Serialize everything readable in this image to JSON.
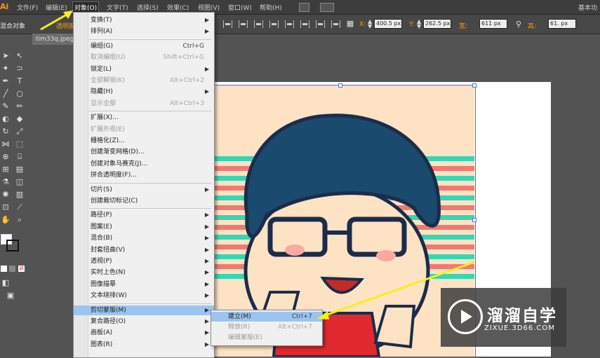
{
  "menubar": {
    "logo": "Ai",
    "items": [
      "文件(F)",
      "编辑(E)",
      "对象(O)",
      "文字(T)",
      "选择(S)",
      "效果(C)",
      "视图(V)",
      "窗口(W)",
      "帮助(H)"
    ],
    "right_label": "基本功"
  },
  "ctrlbar": {
    "left_label": "混合对象",
    "opacity_label": "透明度",
    "x_label": "X:",
    "x_value": "400.5 px",
    "y_label": "Y:",
    "y_value": "262.5 px",
    "w_label": "宽:",
    "w_value": "611 px",
    "h_label": "高:",
    "h_value": "61. px"
  },
  "document": {
    "tab_label": "tim33q.jpeg@"
  },
  "object_menu": [
    {
      "label": "变换(T)",
      "shortcut": "",
      "submenu": true,
      "disabled": false
    },
    {
      "label": "排列(A)",
      "shortcut": "",
      "submenu": true,
      "disabled": false
    },
    {
      "separator": true
    },
    {
      "label": "编组(G)",
      "shortcut": "Ctrl+G",
      "submenu": false,
      "disabled": false
    },
    {
      "label": "取消编组(U)",
      "shortcut": "Shift+Ctrl+G",
      "submenu": false,
      "disabled": true
    },
    {
      "label": "锁定(L)",
      "shortcut": "",
      "submenu": true,
      "disabled": false
    },
    {
      "label": "全部解锁(K)",
      "shortcut": "Alt+Ctrl+2",
      "submenu": false,
      "disabled": true
    },
    {
      "label": "隐藏(H)",
      "shortcut": "",
      "submenu": true,
      "disabled": false
    },
    {
      "label": "显示全部",
      "shortcut": "Alt+Ctrl+3",
      "submenu": false,
      "disabled": true
    },
    {
      "separator": true
    },
    {
      "label": "扩展(X)...",
      "shortcut": "",
      "submenu": false,
      "disabled": false
    },
    {
      "label": "扩展外观(E)",
      "shortcut": "",
      "submenu": false,
      "disabled": true
    },
    {
      "label": "栅格化(Z)...",
      "shortcut": "",
      "submenu": false,
      "disabled": false
    },
    {
      "label": "创建渐变网格(D)...",
      "shortcut": "",
      "submenu": false,
      "disabled": false
    },
    {
      "label": "创建对象马赛克(J)...",
      "shortcut": "",
      "submenu": false,
      "disabled": false
    },
    {
      "label": "拼合透明度(F)...",
      "shortcut": "",
      "submenu": false,
      "disabled": false
    },
    {
      "separator": true
    },
    {
      "label": "切片(S)",
      "shortcut": "",
      "submenu": true,
      "disabled": false
    },
    {
      "label": "创建裁切标记(C)",
      "shortcut": "",
      "submenu": false,
      "disabled": false
    },
    {
      "separator": true
    },
    {
      "label": "路径(P)",
      "shortcut": "",
      "submenu": true,
      "disabled": false
    },
    {
      "label": "图案(E)",
      "shortcut": "",
      "submenu": true,
      "disabled": false
    },
    {
      "label": "混合(B)",
      "shortcut": "",
      "submenu": true,
      "disabled": false
    },
    {
      "label": "封套扭曲(V)",
      "shortcut": "",
      "submenu": true,
      "disabled": false
    },
    {
      "label": "透视(P)",
      "shortcut": "",
      "submenu": true,
      "disabled": false
    },
    {
      "label": "实时上色(N)",
      "shortcut": "",
      "submenu": true,
      "disabled": false
    },
    {
      "label": "图像描摹",
      "shortcut": "",
      "submenu": true,
      "disabled": false
    },
    {
      "label": "文本绕排(W)",
      "shortcut": "",
      "submenu": true,
      "disabled": false
    },
    {
      "separator": true
    },
    {
      "label": "剪切蒙版(M)",
      "shortcut": "",
      "submenu": true,
      "disabled": false,
      "highlighted": true
    },
    {
      "label": "复合路径(O)",
      "shortcut": "",
      "submenu": true,
      "disabled": false
    },
    {
      "label": "画板(A)",
      "shortcut": "",
      "submenu": true,
      "disabled": false
    },
    {
      "label": "图表(R)",
      "shortcut": "",
      "submenu": true,
      "disabled": false
    }
  ],
  "clip_submenu": [
    {
      "label": "建立(M)",
      "shortcut": "Ctrl+7",
      "disabled": false,
      "highlighted": true
    },
    {
      "label": "释放(R)",
      "shortcut": "Alt+Ctrl+7",
      "disabled": true
    },
    {
      "label": "编辑蒙版(E)",
      "shortcut": "",
      "disabled": true
    }
  ],
  "watermark": {
    "title": "溜溜自学",
    "url": "ZIXUE.3D66.COM"
  },
  "colors": {
    "arrow": "#f5f01a",
    "menu_highlight": "#9bc5ee",
    "selection": "#4a6cff",
    "hair": "#1a4a6e",
    "stripe_teal": "#36d6b4",
    "stripe_salmon": "#f07a70",
    "skin": "#fde2c4"
  }
}
